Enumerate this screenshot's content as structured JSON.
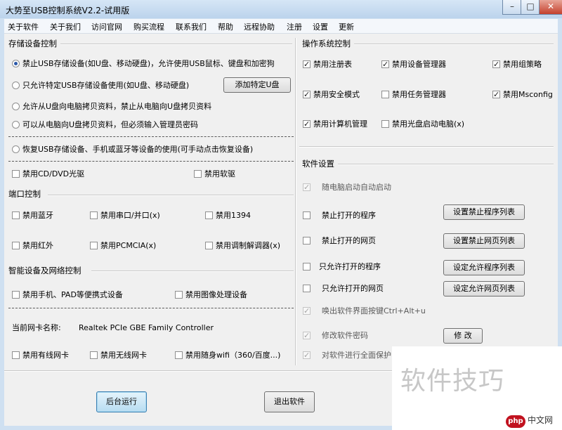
{
  "window": {
    "title": "大势至USB控制系统V2.2-试用版",
    "minimize": "–",
    "maximize": "□",
    "close": "✕"
  },
  "menu": [
    "关于软件",
    "关于我们",
    "访问官网",
    "购买流程",
    "联系我们",
    "帮助",
    "远程协助",
    "注册",
    "设置",
    "更新"
  ],
  "storage": {
    "title": "存储设备控制",
    "radio_options": [
      "禁止USB存储设备(如U盘、移动硬盘)，允许使用USB鼠标、键盘和加密狗",
      "只允许特定USB存储设备使用(如U盘、移动硬盘)",
      "允许从U盘向电脑拷贝资料，禁止从电脑向U盘拷贝资料",
      "可以从电脑向U盘拷贝资料，但必须输入管理员密码",
      "恢复USB存储设备、手机或蓝牙等设备的使用(可手动点击恢复设备)"
    ],
    "selected_index": 0,
    "add_button": "添加特定U盘",
    "checkbox_cd": "禁用CD/DVD光驱",
    "checkbox_floppy": "禁用软驱"
  },
  "ports": {
    "title": "端口控制",
    "items": [
      "禁用蓝牙",
      "禁用串口/并口(x)",
      "禁用1394",
      "禁用红外",
      "禁用PCMCIA(x)",
      "禁用调制解调器(x)"
    ]
  },
  "smart": {
    "title": "智能设备及网络控制",
    "items": [
      "禁用手机、PAD等便携式设备",
      "禁用图像处理设备"
    ],
    "nic_label": "当前网卡名称:",
    "nic_value": "Realtek PCIe GBE Family Controller",
    "net_items": [
      "禁用有线网卡",
      "禁用无线网卡",
      "禁用随身wifi（360/百度...)"
    ]
  },
  "os": {
    "title": "操作系统控制",
    "items": [
      {
        "label": "禁用注册表",
        "checked": true
      },
      {
        "label": "禁用设备管理器",
        "checked": true
      },
      {
        "label": "禁用组策略",
        "checked": true
      },
      {
        "label": "禁用安全模式",
        "checked": true
      },
      {
        "label": "禁用任务管理器",
        "checked": false
      },
      {
        "label": "禁用Msconfig",
        "checked": true
      },
      {
        "label": "禁用计算机管理",
        "checked": true
      },
      {
        "label": "禁用光盘启动电脑(x)",
        "checked": false
      }
    ]
  },
  "software": {
    "title": "软件设置",
    "items": [
      {
        "label": "随电脑启动自动启动",
        "checked": true,
        "disabled": true
      },
      {
        "label": "禁止打开的程序",
        "checked": false,
        "disabled": false,
        "button": "设置禁止程序列表"
      },
      {
        "label": "禁止打开的网页",
        "checked": false,
        "disabled": false,
        "button": "设置禁止网页列表"
      },
      {
        "label": "只允许打开的程序",
        "checked": false,
        "disabled": false,
        "button": "设定允许程序列表"
      },
      {
        "label": "只允许打开的网页",
        "checked": false,
        "disabled": false,
        "button": "设定允许网页列表"
      },
      {
        "label": "唤出软件界面按键Ctrl+Alt+u",
        "checked": true,
        "disabled": true
      },
      {
        "label": "修改软件密码",
        "checked": true,
        "disabled": true,
        "button": "修 改"
      },
      {
        "label": "对软件进行全面保护",
        "checked": true,
        "disabled": true
      }
    ]
  },
  "footer": {
    "run_background": "后台运行",
    "exit": "退出软件"
  },
  "watermark": {
    "text": "软件技巧",
    "logo_badge": "php",
    "logo_text": "中文网"
  }
}
